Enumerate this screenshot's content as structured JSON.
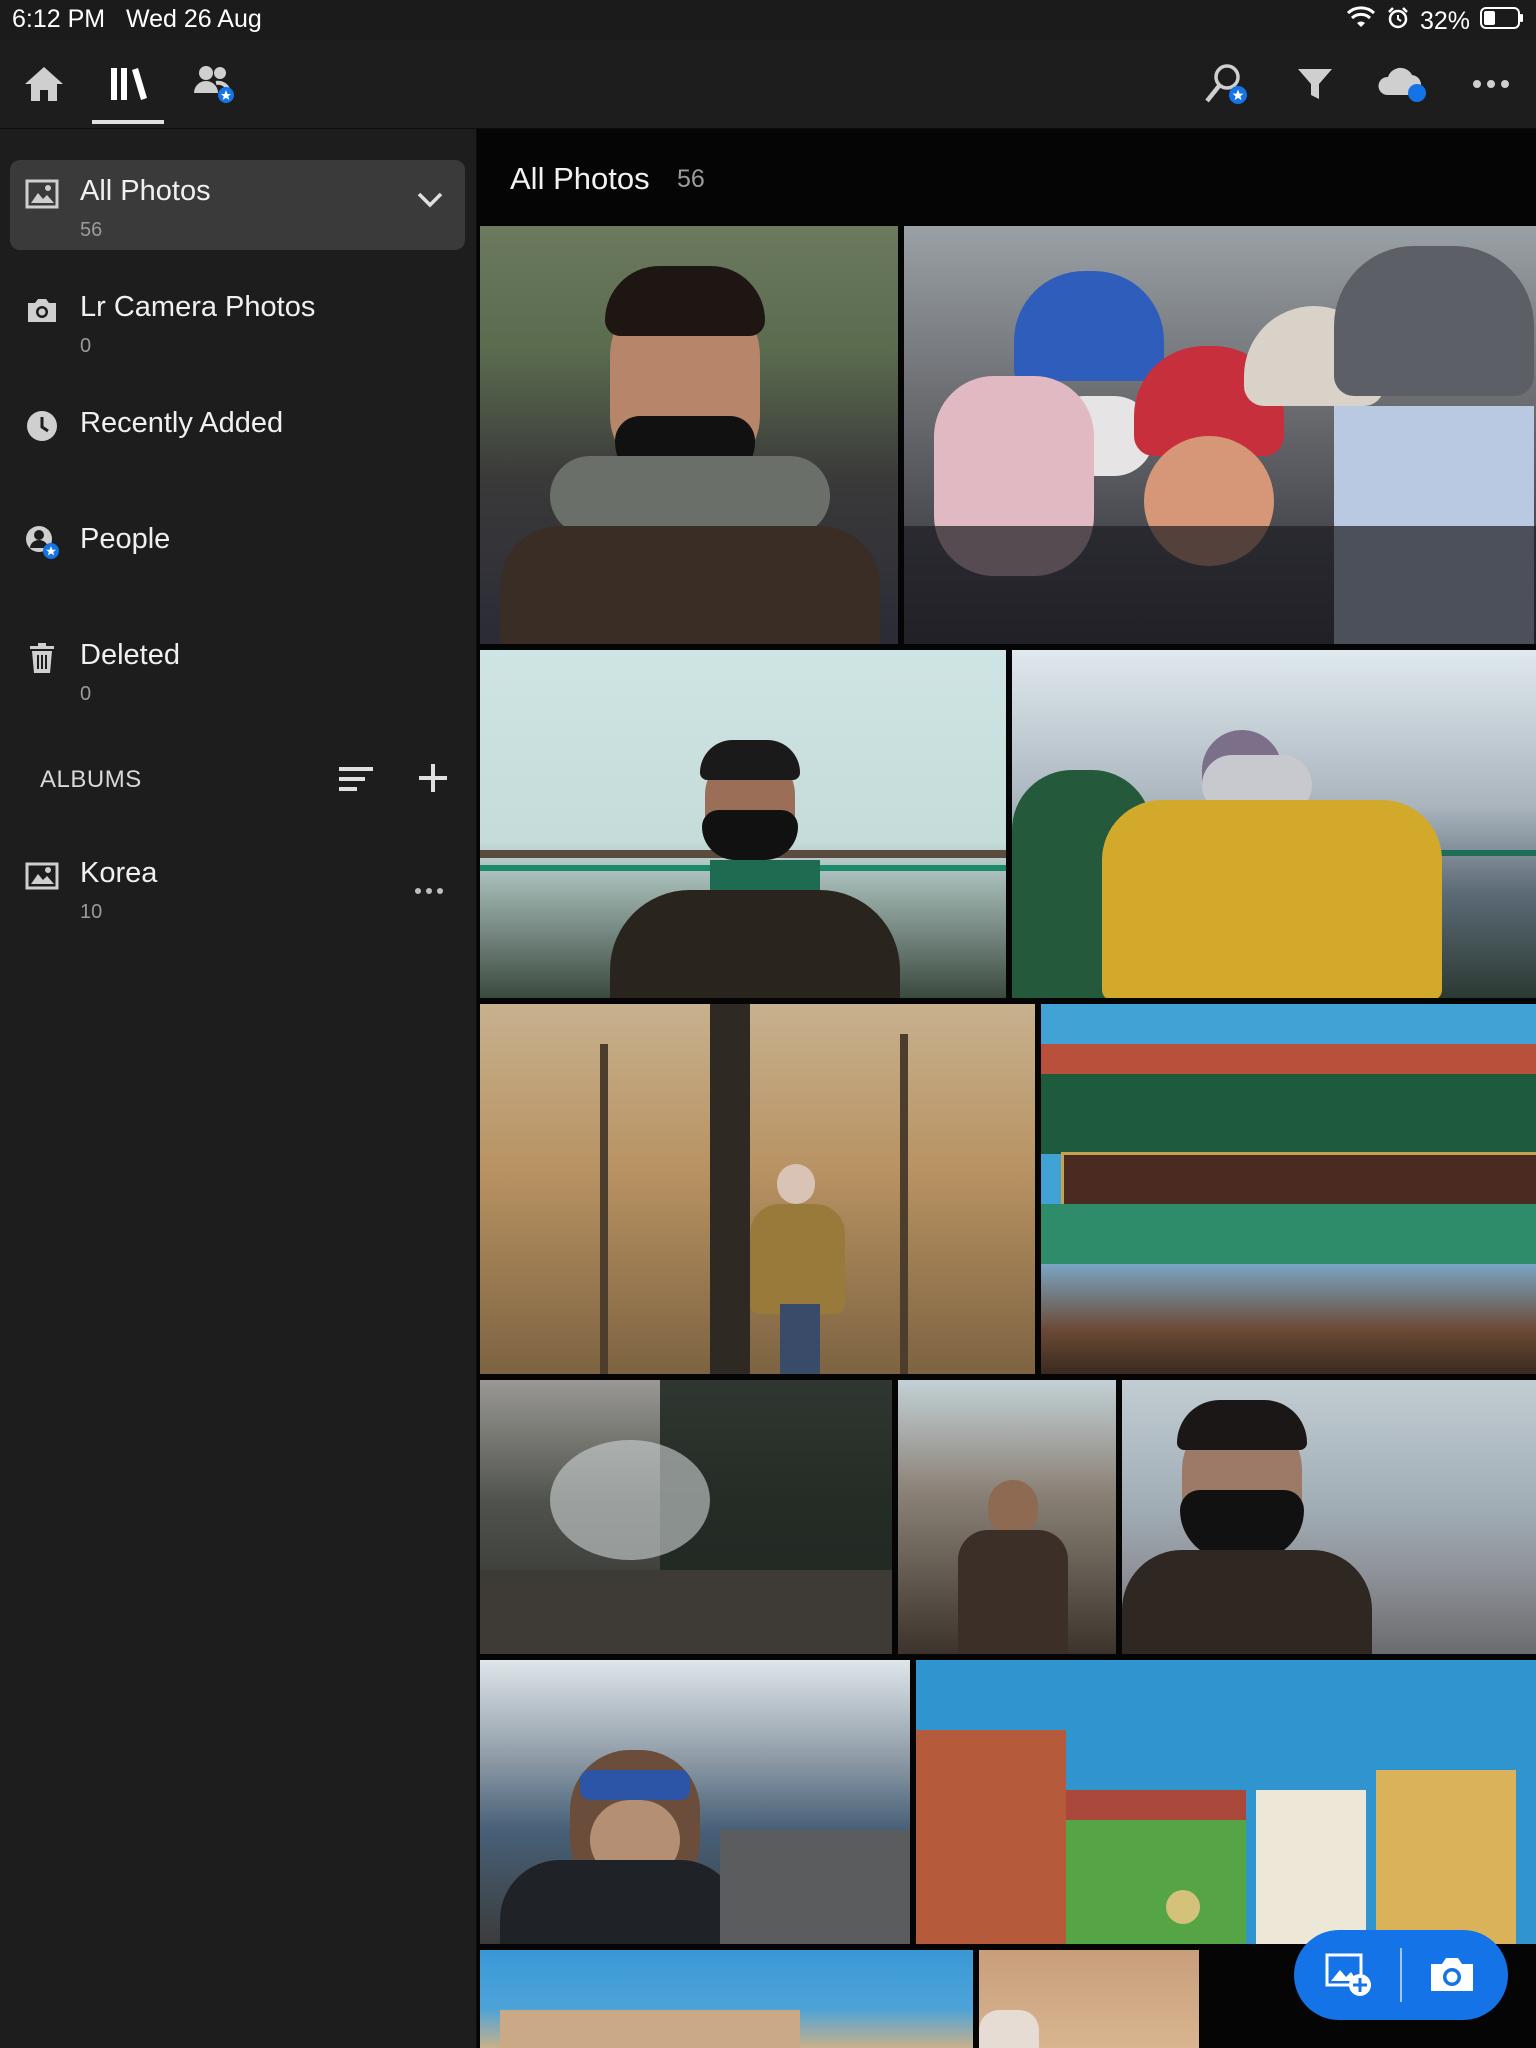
{
  "status_bar": {
    "time": "6:12 PM",
    "date": "Wed 26 Aug",
    "battery": "32%"
  },
  "toolbar": {
    "left_icons": [
      "home-icon",
      "library-icon",
      "shared-people-icon"
    ],
    "right_icons": [
      "search-people-icon",
      "filter-icon",
      "cloud-sync-icon",
      "more-icon"
    ]
  },
  "sidebar": {
    "items": [
      {
        "label": "All Photos",
        "count": "56"
      },
      {
        "label": "Lr Camera Photos",
        "count": "0"
      },
      {
        "label": "Recently Added",
        "count": ""
      },
      {
        "label": "People",
        "count": ""
      },
      {
        "label": "Deleted",
        "count": "0"
      }
    ],
    "albums_heading": "ALBUMS",
    "albums": [
      {
        "label": "Korea",
        "count": "10"
      }
    ]
  },
  "main": {
    "title": "All Photos",
    "count": "56"
  },
  "colors": {
    "accent": "#1473e6",
    "sidebar_bg": "#1d1d1d",
    "grid_bg": "#050505",
    "active_row": "#3a3a3a"
  }
}
